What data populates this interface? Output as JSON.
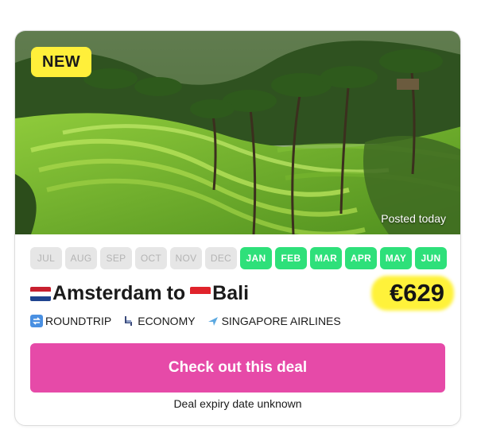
{
  "badge": "NEW",
  "posted": "Posted today",
  "months": [
    {
      "label": "JUL",
      "active": false
    },
    {
      "label": "AUG",
      "active": false
    },
    {
      "label": "SEP",
      "active": false
    },
    {
      "label": "OCT",
      "active": false
    },
    {
      "label": "NOV",
      "active": false
    },
    {
      "label": "DEC",
      "active": false
    },
    {
      "label": "JAN",
      "active": true
    },
    {
      "label": "FEB",
      "active": true
    },
    {
      "label": "MAR",
      "active": true
    },
    {
      "label": "APR",
      "active": true
    },
    {
      "label": "MAY",
      "active": true
    },
    {
      "label": "JUN",
      "active": true
    }
  ],
  "route": {
    "origin": "Amsterdam",
    "connector": "to",
    "destination": "Bali"
  },
  "price": "€629",
  "features": {
    "trip_type": "ROUNDTRIP",
    "cabin": "ECONOMY",
    "airline": "SINGAPORE AIRLINES"
  },
  "cta_label": "Check out this deal",
  "expiry": "Deal expiry date unknown",
  "colors": {
    "active_month": "#2ee07a",
    "cta": "#e64aa8",
    "highlight": "#ffef3a"
  }
}
